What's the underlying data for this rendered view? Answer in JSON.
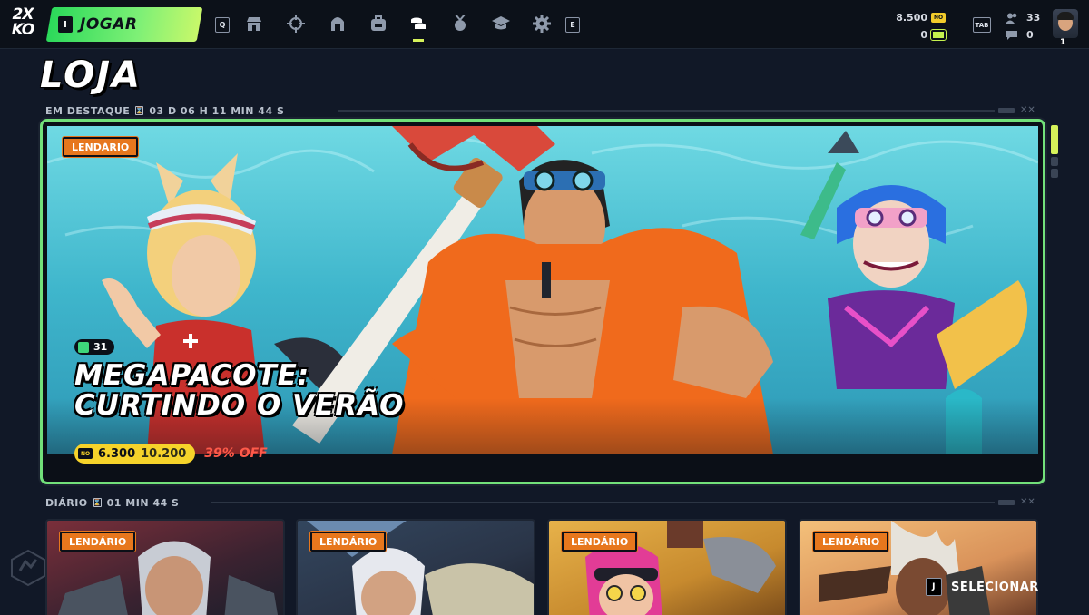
{
  "topbar": {
    "logo": "2XKO",
    "play_key": "I",
    "play_label": "JOGAR",
    "left_key": "Q",
    "right_key": "E",
    "nav_icons": [
      "store-icon",
      "crosshair-icon",
      "helmet-icon",
      "backpack-icon",
      "coins-icon",
      "medal-icon",
      "graduation-cap-icon",
      "gear-icon"
    ],
    "active_nav": "coins-icon",
    "currency_primary": "8.500",
    "currency_primary_icon": "NO",
    "currency_secondary": "0",
    "tab_key": "TAB",
    "friends_count": "33",
    "messages_count": "0",
    "player_level": "1"
  },
  "page": {
    "title": "LOJA"
  },
  "featured_section": {
    "label": "EM DESTAQUE",
    "timer": "03 D 06 H 11 MIN 44 S",
    "item": {
      "rarity": "LENDÁRIO",
      "count": "31",
      "title_line1": "MEGAPACOTE:",
      "title_line2": "CURTINDO O VERÃO",
      "price": "6.300",
      "old_price": "10.200",
      "discount": "39% OFF"
    }
  },
  "daily_section": {
    "label": "DIÁRIO",
    "timer": "01 MIN 44 S",
    "cards": [
      {
        "rarity": "LENDÁRIO"
      },
      {
        "rarity": "LENDÁRIO"
      },
      {
        "rarity": "LENDÁRIO"
      },
      {
        "rarity": "LENDÁRIO"
      }
    ]
  },
  "hint": {
    "key": "J",
    "label": "SELECIONAR"
  },
  "colors": {
    "accent_green": "#72e07a",
    "legendary_orange": "#e7771d",
    "price_yellow": "#f6d32a",
    "discount_red": "#ff5a4a",
    "background": "#111827"
  }
}
